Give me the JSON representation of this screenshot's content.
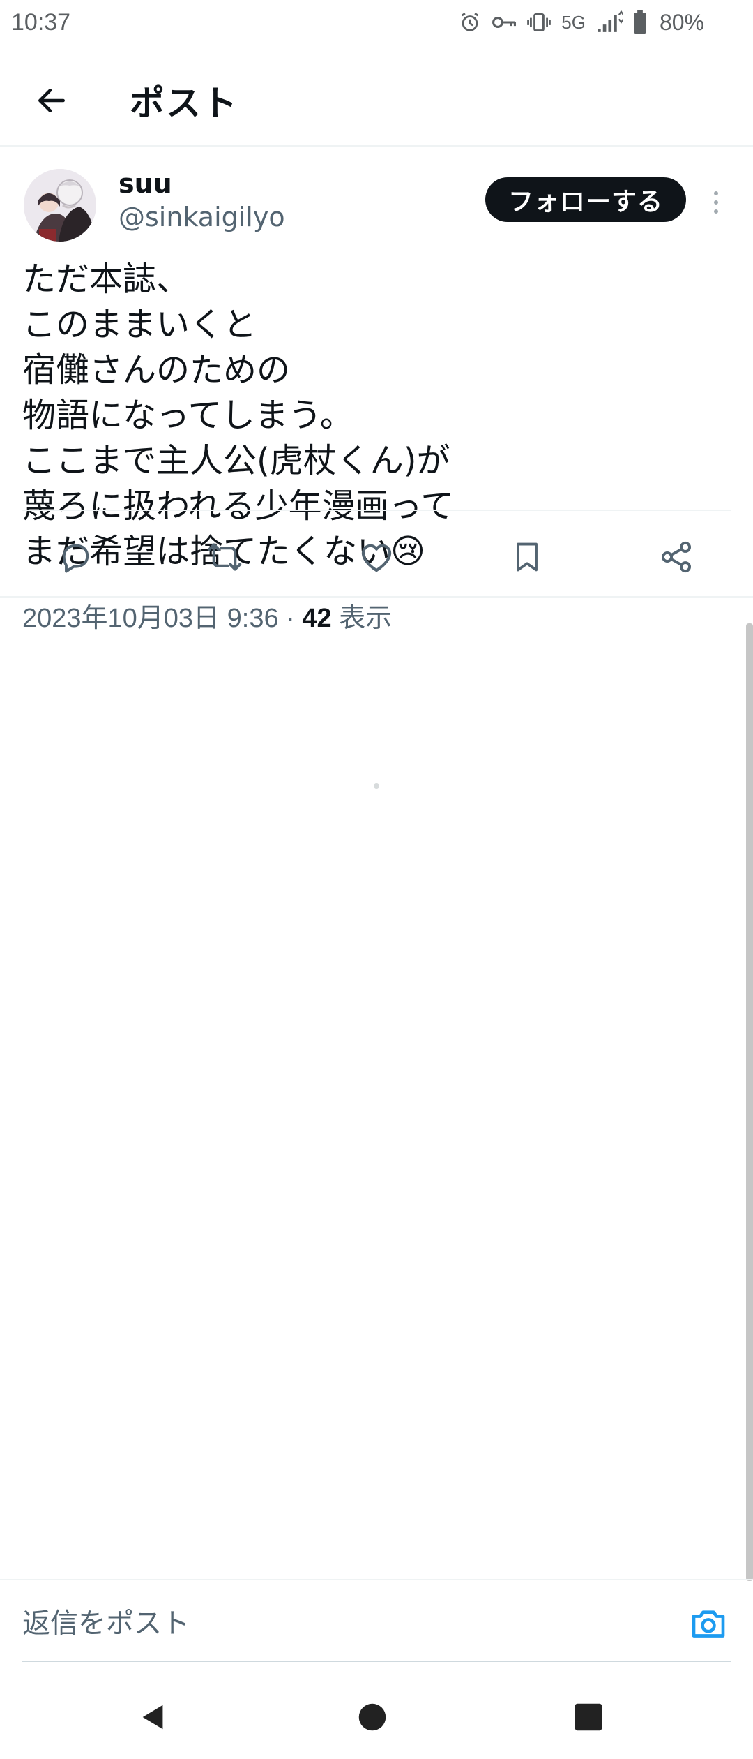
{
  "status_bar": {
    "time": "10:37",
    "network": "5G",
    "battery": "80%",
    "icons": [
      "alarm-icon",
      "key-icon",
      "vibrate-icon",
      "signal-icon",
      "battery-icon"
    ]
  },
  "header": {
    "title": "ポスト",
    "back_icon": "arrow-left-icon"
  },
  "post": {
    "author": {
      "display_name": "suu",
      "handle": "@sinkaigilyo"
    },
    "follow_label": "フォローする",
    "text": "ただ本誌、\nこのままいくと\n宿儺さんのための\n物語になってしまう。\nここまで主人公(虎杖くん)が\n蔑ろに扱われる少年漫画って\nまだ希望は捨てたくない😢",
    "timestamp": "2023年10月03日 9:36",
    "separator": " · ",
    "views_count": "42",
    "views_label": " 表示"
  },
  "actions": [
    {
      "name": "reply",
      "icon": "reply-icon"
    },
    {
      "name": "repost",
      "icon": "repost-icon"
    },
    {
      "name": "like",
      "icon": "heart-icon"
    },
    {
      "name": "bookmark",
      "icon": "bookmark-icon"
    },
    {
      "name": "share",
      "icon": "share-icon"
    }
  ],
  "reply_bar": {
    "placeholder": "返信をポスト",
    "camera_icon": "camera-icon"
  },
  "colors": {
    "accent": "#1d9bf0",
    "text_primary": "#0f1419",
    "text_secondary": "#536471",
    "divider": "#eff3f4"
  }
}
